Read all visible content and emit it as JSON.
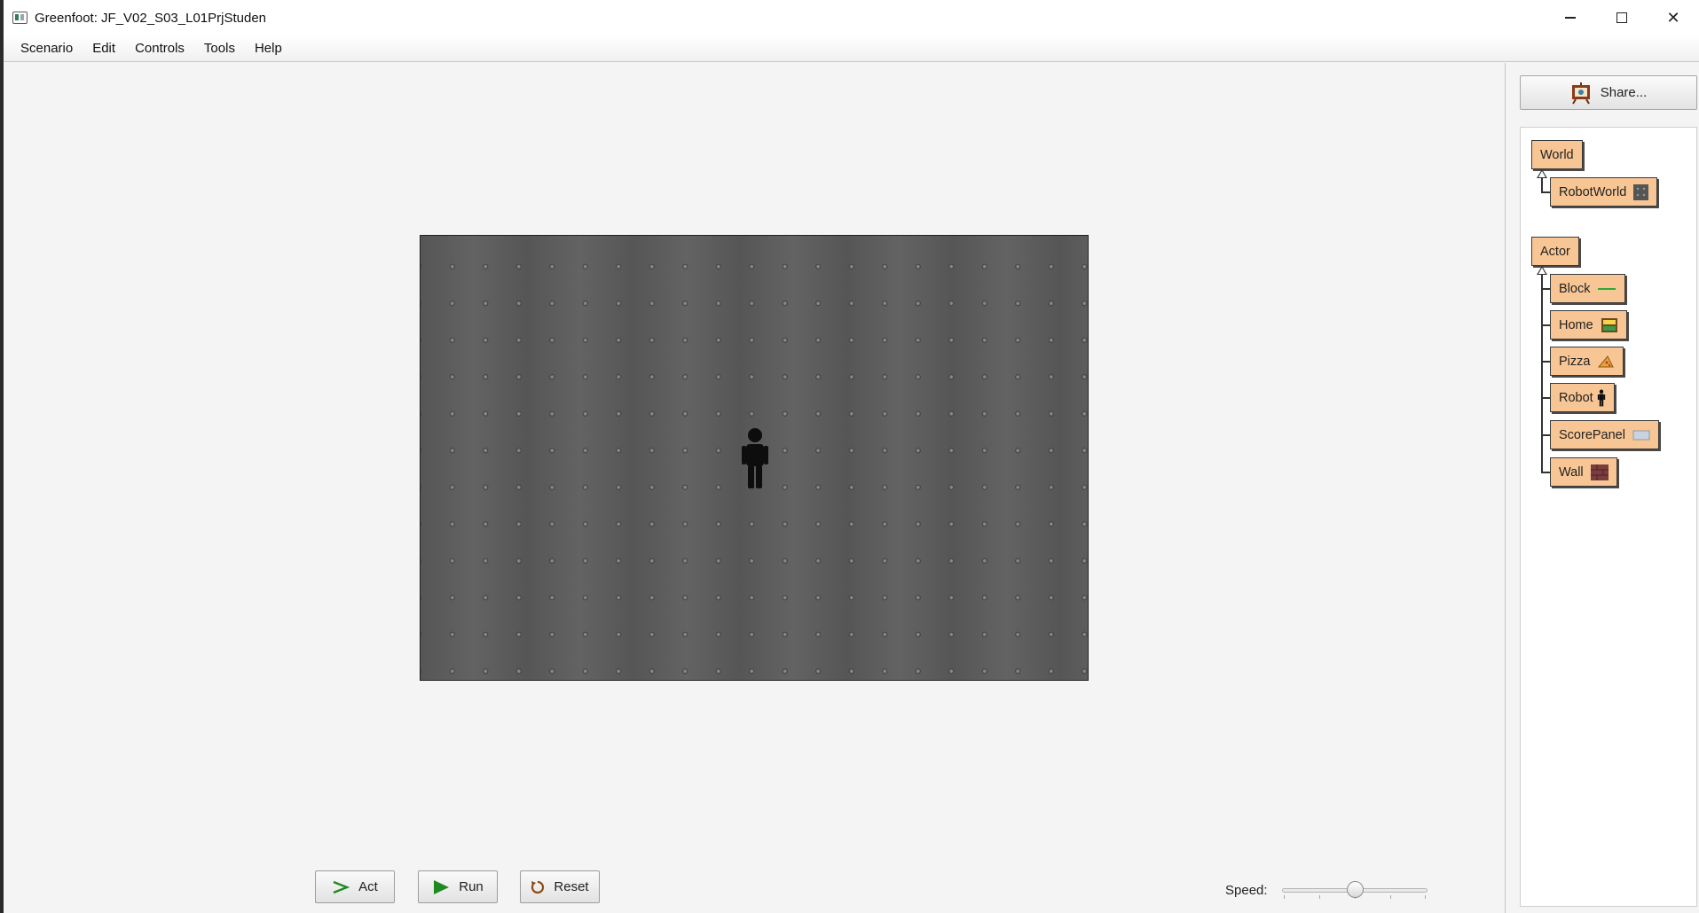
{
  "window": {
    "title": "Greenfoot: JF_V02_S03_L01PrjStuden",
    "minimize_glyph": "",
    "maximize_glyph": "",
    "close_glyph": "✕"
  },
  "menu": [
    "Scenario",
    "Edit",
    "Controls",
    "Tools",
    "Help"
  ],
  "controls": {
    "act_label": "Act",
    "run_label": "Run",
    "reset_label": "Reset",
    "speed_label": "Speed:",
    "speed_value": 0.5
  },
  "share": {
    "label": "Share..."
  },
  "classes": {
    "world_root": "World",
    "world_subclasses": [
      "RobotWorld"
    ],
    "actor_root": "Actor",
    "actor_subclasses": [
      "Block",
      "Home",
      "Pizza",
      "Robot",
      "ScorePanel",
      "Wall"
    ]
  },
  "colors": {
    "class_box": "#f8c695",
    "world_background": "#5a5b5a",
    "accent_green": "#1f8a1f"
  },
  "icons": {
    "app": "greenfoot-app-icon",
    "act": "act-arrow-icon",
    "run": "run-play-icon",
    "reset": "reset-circular-icon",
    "share": "share-easel-icon"
  }
}
